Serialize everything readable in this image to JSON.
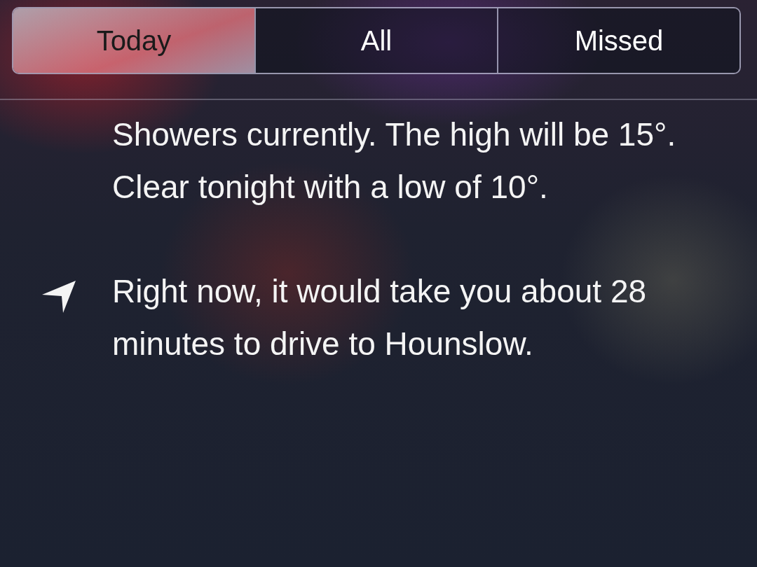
{
  "tabs": [
    {
      "label": "Today",
      "selected": true
    },
    {
      "label": "All",
      "selected": false
    },
    {
      "label": "Missed",
      "selected": false
    }
  ],
  "items": [
    {
      "kind": "text",
      "text": "Showers currently. The high will be 15°. Clear tonight with a low of 10°."
    },
    {
      "kind": "location",
      "text": "Right now, it would take you about 28 minutes to drive to Hounslow."
    }
  ]
}
